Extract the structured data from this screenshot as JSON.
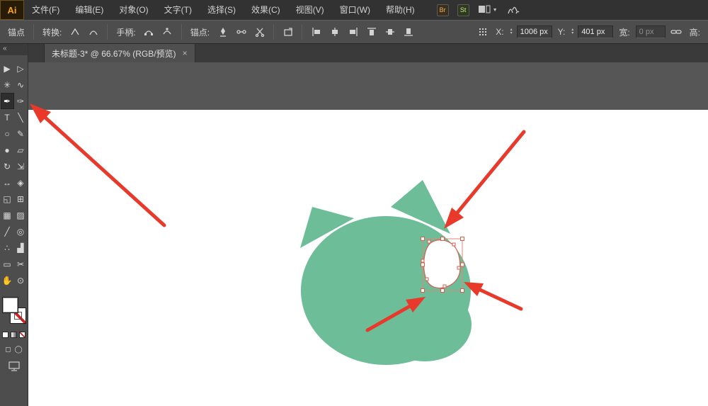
{
  "colors": {
    "menubar_bg": "#323232",
    "panel_bg": "#4d4d4d",
    "pasteboard": "#565656",
    "artboard": "#ffffff",
    "shape_green": "#6cbd98",
    "annotation_red": "#e8392a",
    "selection_outline": "#d4604f",
    "logo_orange": "#f7a31b"
  },
  "menubar": {
    "logo": "Ai",
    "items": [
      {
        "label": "文件(F)"
      },
      {
        "label": "编辑(E)"
      },
      {
        "label": "对象(O)"
      },
      {
        "label": "文字(T)"
      },
      {
        "label": "选择(S)"
      },
      {
        "label": "效果(C)"
      },
      {
        "label": "视图(V)"
      },
      {
        "label": "窗口(W)"
      },
      {
        "label": "帮助(H)"
      }
    ],
    "br_badge": "Br",
    "st_badge": "St",
    "arrange_caret": "▼"
  },
  "control_bar": {
    "selection_label": "锚点",
    "convert_label": "转换:",
    "handles_label": "手柄:",
    "anchors_label": "锚点:",
    "x_label": "X:",
    "x_value": "1006 px",
    "y_label": "Y:",
    "y_value": "401 px",
    "width_label": "宽:",
    "width_value": "0 px",
    "height_label": "高:",
    "spinner_up": "▴",
    "spinner_down": "▾"
  },
  "tab": {
    "title": "未标题-3* @ 66.67% (RGB/预览)",
    "close_glyph": "×"
  },
  "toolbar": {
    "collapse_glyph": "«",
    "draw_mode_1": "◻",
    "draw_mode_2": "◯",
    "tools": [
      {
        "name": "selection-tool",
        "glyph": "▶"
      },
      {
        "name": "direct-selection-tool",
        "glyph": "▷"
      },
      {
        "name": "magic-wand-tool",
        "glyph": "✳"
      },
      {
        "name": "lasso-tool",
        "glyph": "∿"
      },
      {
        "name": "pen-tool",
        "glyph": "✒"
      },
      {
        "name": "paintbrush-tool",
        "glyph": "✑"
      },
      {
        "name": "type-tool",
        "glyph": "T"
      },
      {
        "name": "line-segment-tool",
        "glyph": "╲"
      },
      {
        "name": "ellipse-tool",
        "glyph": "○"
      },
      {
        "name": "pencil-tool",
        "glyph": "✎"
      },
      {
        "name": "blob-brush-tool",
        "glyph": "●"
      },
      {
        "name": "eraser-tool",
        "glyph": "▱"
      },
      {
        "name": "rotate-tool",
        "glyph": "↻"
      },
      {
        "name": "scale-tool",
        "glyph": "⇲"
      },
      {
        "name": "width-tool",
        "glyph": "↔"
      },
      {
        "name": "free-transform-tool",
        "glyph": "◈"
      },
      {
        "name": "shape-builder-tool",
        "glyph": "◱"
      },
      {
        "name": "perspective-grid-tool",
        "glyph": "⊞"
      },
      {
        "name": "mesh-tool",
        "glyph": "▦"
      },
      {
        "name": "gradient-tool",
        "glyph": "▨"
      },
      {
        "name": "eyedropper-tool",
        "glyph": "╱"
      },
      {
        "name": "blend-tool",
        "glyph": "◎"
      },
      {
        "name": "symbol-sprayer-tool",
        "glyph": "∴"
      },
      {
        "name": "column-graph-tool",
        "glyph": "▟"
      },
      {
        "name": "artboard-tool",
        "glyph": "▭"
      },
      {
        "name": "slice-tool",
        "glyph": "✂"
      },
      {
        "name": "hand-tool",
        "glyph": "✋"
      },
      {
        "name": "zoom-tool",
        "glyph": "⊙"
      }
    ]
  }
}
